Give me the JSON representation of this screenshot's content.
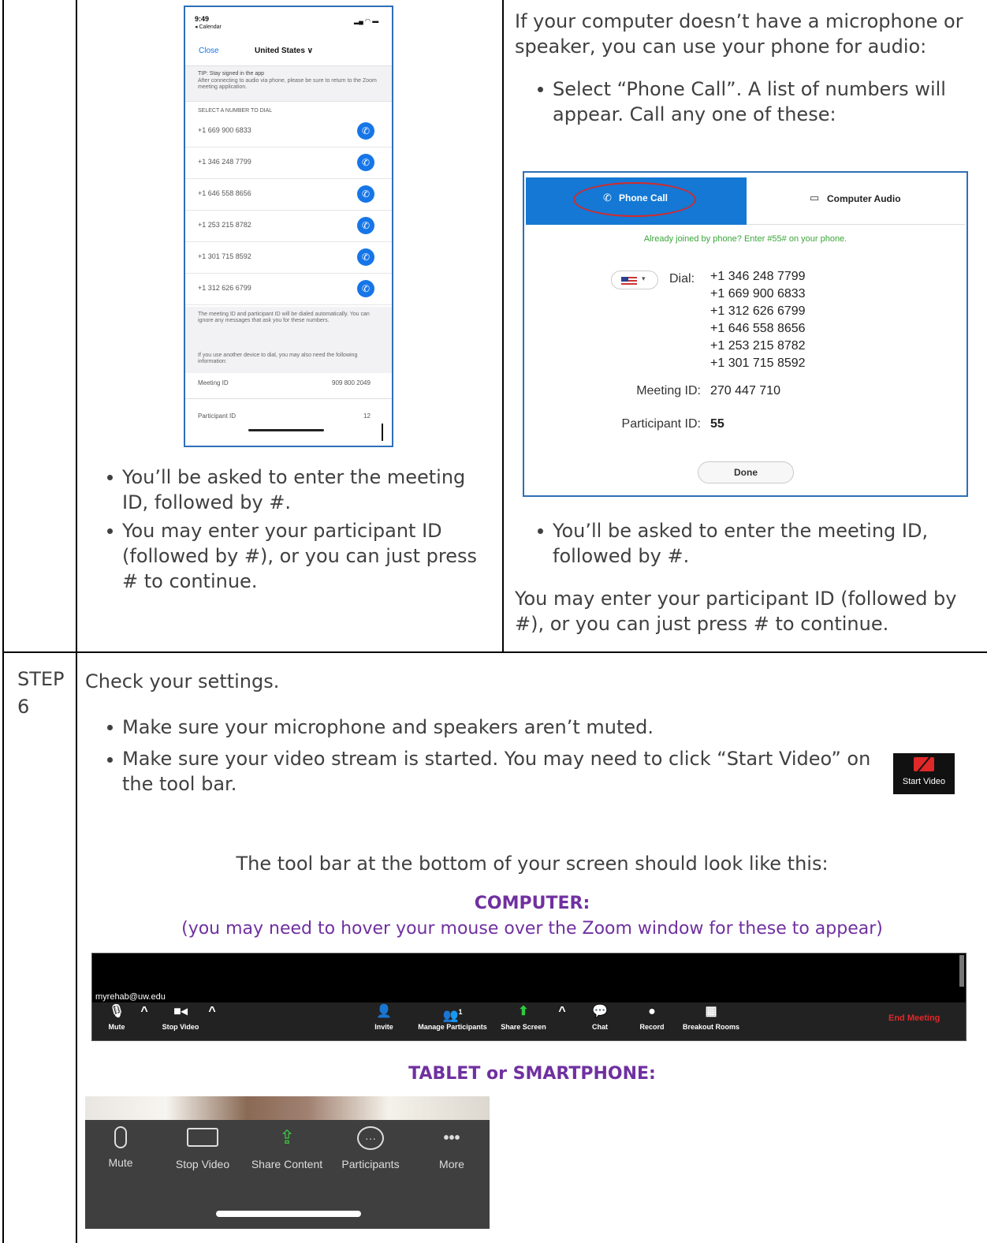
{
  "top_right": {
    "intro": "If your computer doesn’t have a microphone or speaker, you can use your phone for audio:",
    "bullet1": "Select “Phone Call”.  A list of numbers will appear.  Call any one of these:",
    "bullet2": "You’ll be asked to enter the meeting ID, followed by #.",
    "para": "You may enter your participant ID (followed by #), or you can just press # to continue."
  },
  "top_left": {
    "bullet1": "You’ll be asked to enter the meeting ID, followed by #.",
    "bullet2": "You may enter your participant ID (followed by #), or you can just press # to continue."
  },
  "phone_screen": {
    "time": "9:49",
    "back": "◂ Calendar",
    "close": "Close",
    "country": "United States ∨",
    "tip_title": "TIP: Stay signed in the app",
    "tip_text": "After connecting to audio via phone, please be sure to return to the Zoom meeting application.",
    "select_header": "SELECT A NUMBER TO DIAL",
    "numbers": [
      "+1 669 900 6833",
      "+1 346 248 7799",
      "+1 646 558 8656",
      "+1 253 215 8782",
      "+1 301 715 8592",
      "+1 312 626 6799"
    ],
    "note1": "The meeting ID and participant ID will be dialed automatically. You can ignore any messages that ask you for these numbers.",
    "note2": "If you use another device to dial, you may also need the following information:",
    "meeting_id_label": "Meeting ID",
    "meeting_id_value": "909 800 2049",
    "participant_id_label": "Participant ID",
    "participant_id_value": "12"
  },
  "dialog": {
    "tab_phone": "Phone Call",
    "tab_computer": "Computer Audio",
    "already_joined": "Already joined by phone? Enter #55# on your phone.",
    "dial_label": "Dial:",
    "numbers": [
      "+1 346 248 7799",
      "+1 669 900 6833",
      "+1 312 626 6799",
      "+1 646 558 8656",
      "+1 253 215 8782",
      "+1 301 715 8592"
    ],
    "meeting_id_label": "Meeting ID:",
    "meeting_id_value": "270 447 710",
    "participant_id_label": "Participant ID:",
    "participant_id_value": "55",
    "done": "Done"
  },
  "step6": {
    "step_label": "STEP",
    "step_num": "6",
    "title": "Check your settings.",
    "bullet1": "Make sure your microphone and speakers aren’t muted.",
    "bullet2": "Make sure your video stream is started.  You may need to click “Start Video” on the tool bar.",
    "start_video_label": "Start Video",
    "toolbar_intro": "The tool bar at the bottom of your screen should look like this:",
    "computer_heading": "COMPUTER:",
    "computer_note": "(you may need to hover your mouse over the Zoom window for these to appear)",
    "tablet_heading": "TABLET or SMARTPHONE:"
  },
  "computer_toolbar": {
    "user": "myrehab@uw.edu",
    "mute": "Mute",
    "stop_video": "Stop Video",
    "invite": "Invite",
    "manage_participants": "Manage Participants",
    "participant_count": "1",
    "share_screen": "Share Screen",
    "chat": "Chat",
    "record": "Record",
    "breakout_rooms": "Breakout Rooms",
    "end_meeting": "End Meeting"
  },
  "tablet_toolbar": {
    "mute": "Mute",
    "stop_video": "Stop Video",
    "share_content": "Share Content",
    "participants": "Participants",
    "more": "More"
  },
  "colors": {
    "heading_purple": "#7030a0",
    "zoom_blue": "#1478d4",
    "end_meeting_red": "#e02828",
    "share_green": "#2ecc40"
  }
}
